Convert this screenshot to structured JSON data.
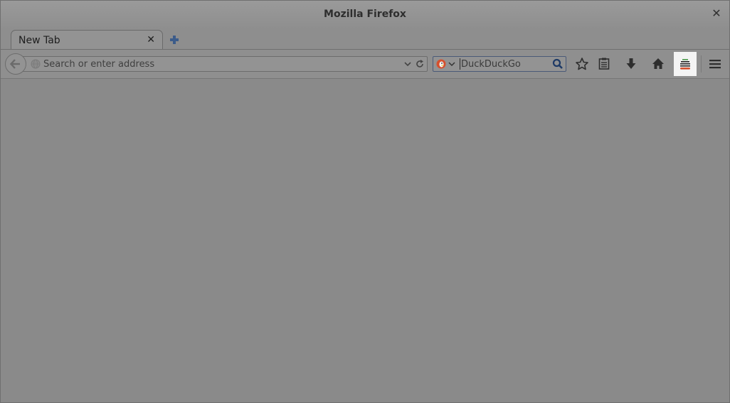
{
  "window": {
    "title": "Mozilla Firefox",
    "close_symbol": "✕"
  },
  "tabs": [
    {
      "label": "New Tab",
      "close_symbol": "✕",
      "active": true
    }
  ],
  "navbar": {
    "url": {
      "value": "",
      "placeholder": "Search or enter address"
    },
    "search": {
      "engine": "DuckDuckGo",
      "value": "",
      "placeholder": "DuckDuckGo"
    },
    "icons": {
      "back": "back-arrow-icon",
      "globe": "globe-icon",
      "url_dropdown": "chevron-down-icon",
      "reload": "reload-icon",
      "engine": "duckduckgo-icon",
      "engine_dropdown": "chevron-down-icon",
      "search_go": "magnifier-icon",
      "bookmark": "star-icon",
      "reading_list": "clipboard-icon",
      "downloads": "download-arrow-icon",
      "home": "home-icon",
      "addon": "layers-addon-icon",
      "menu": "hamburger-icon"
    }
  },
  "colors": {
    "chrome": "#8f8f8f",
    "content": "#8a8a8a",
    "addon_highlight": "#f4f4f4",
    "duckduckgo": "#d5502e",
    "newtab_plus": "#3c5c8a",
    "search_focus_border": "#4a5a78"
  }
}
